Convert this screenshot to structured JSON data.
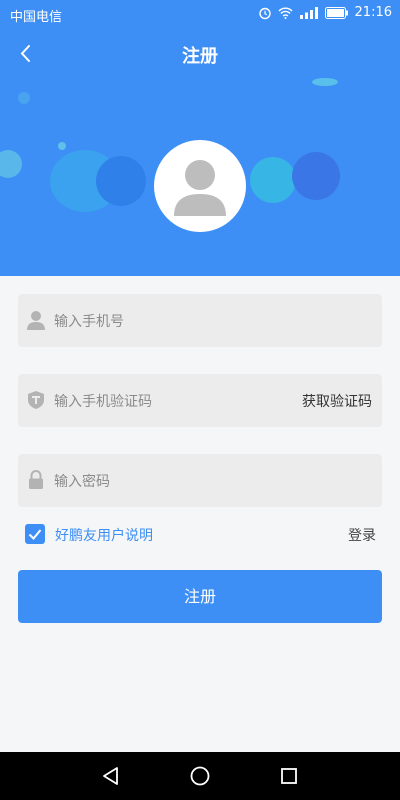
{
  "status_bar": {
    "carrier": "中国电信",
    "time": "21:16",
    "icons": [
      "alarm-icon",
      "wifi-icon",
      "signal-icon",
      "battery-icon"
    ]
  },
  "nav": {
    "title": "注册",
    "back_icon": "chevron-left-icon"
  },
  "form": {
    "phone": {
      "placeholder": "输入手机号",
      "icon": "user-icon"
    },
    "code": {
      "placeholder": "输入手机验证码",
      "icon": "shield-icon",
      "get_code_label": "获取验证码"
    },
    "password": {
      "placeholder": "输入密码",
      "icon": "lock-icon"
    },
    "agreement": {
      "label": "好鹏友用户说明",
      "checked": true
    },
    "login_link": "登录",
    "submit_label": "注册"
  },
  "colors": {
    "primary": "#3d8ff5",
    "background": "#f5f6f8",
    "field_bg": "#ececec"
  },
  "system_nav": [
    "back-triangle-icon",
    "home-circle-icon",
    "recents-square-icon"
  ]
}
